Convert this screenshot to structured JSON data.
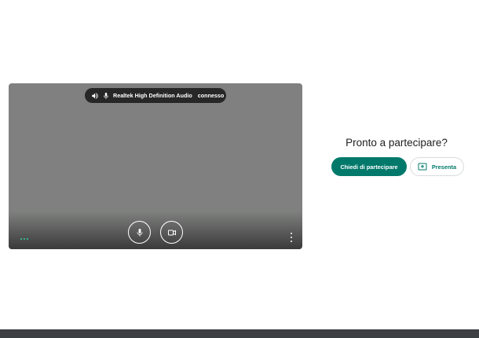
{
  "preview": {
    "audio_chip": {
      "device": "Realtek High Definition Audio",
      "status": "connesso"
    }
  },
  "join_panel": {
    "title": "Pronto a partecipare?",
    "join_label": "Chiedi di partecipare",
    "present_label": "Presenta"
  },
  "colors": {
    "accent": "#00796b",
    "preview_bg": "#7f807f",
    "audio_indicator": "#34d3a8"
  }
}
